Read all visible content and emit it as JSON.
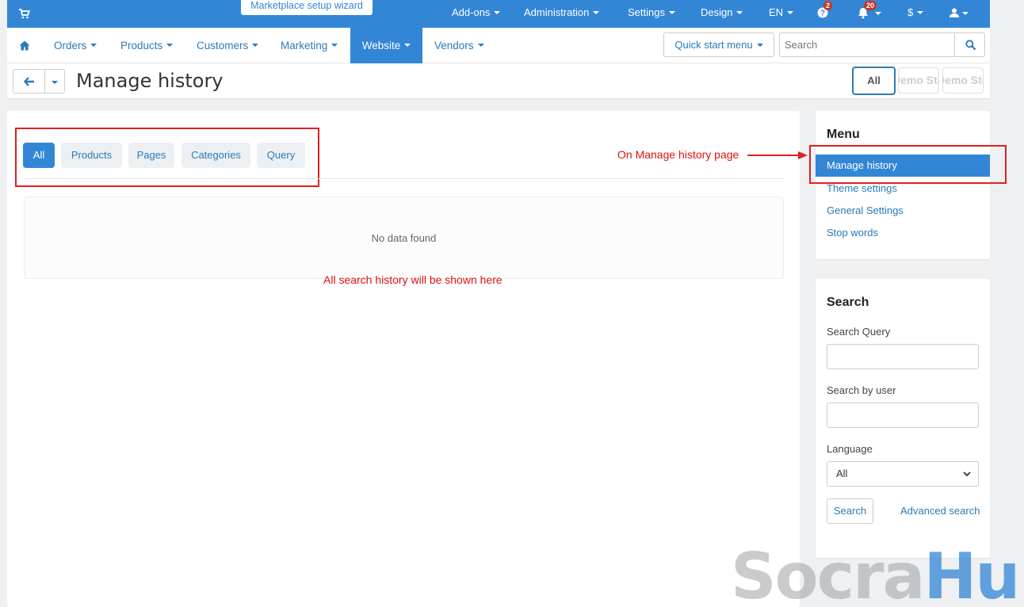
{
  "topbar": {
    "wizard": "Marketplace setup wizard",
    "items": [
      "Add-ons",
      "Administration",
      "Settings",
      "Design",
      "EN"
    ],
    "help_badge": "2",
    "notif_badge": "20",
    "currency": "$"
  },
  "nav": {
    "items": [
      "Orders",
      "Products",
      "Customers",
      "Marketing",
      "Website",
      "Vendors"
    ],
    "active": "Website",
    "quick_start": "Quick start menu",
    "search_placeholder": "Search"
  },
  "title": {
    "text": "Manage history",
    "store_all": "All",
    "store_1": "Demo Store",
    "store_2": "Demo Store"
  },
  "tabs": [
    "All",
    "Products",
    "Pages",
    "Categories",
    "Query"
  ],
  "empty_text": "No data found",
  "notes": {
    "menu_note": "On Manage history page",
    "list_note": "All search history will be shown here"
  },
  "side_menu": {
    "heading": "Menu",
    "items": [
      "Manage history",
      "Theme settings",
      "General Settings",
      "Stop words"
    ]
  },
  "side_search": {
    "heading": "Search",
    "query_label": "Search Query",
    "user_label": "Search by user",
    "language_label": "Language",
    "language_value": "All",
    "search_button": "Search",
    "advanced_link": "Advanced search"
  },
  "logo": {
    "part1": "Socra",
    "part2": "Hub"
  },
  "colors": {
    "primary": "#3386d6",
    "annotation": "#e02020"
  }
}
